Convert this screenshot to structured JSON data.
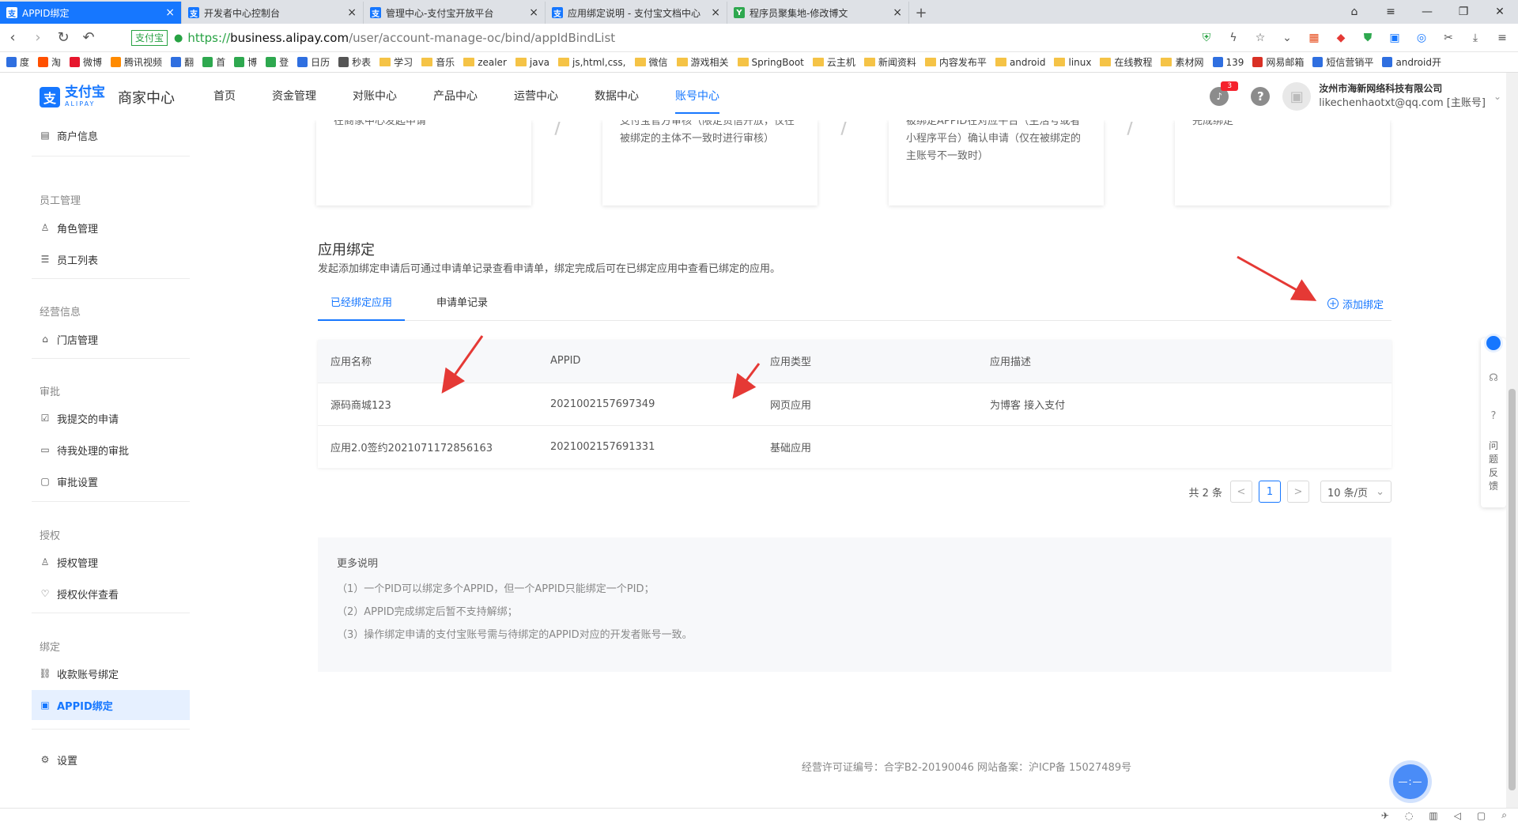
{
  "browser": {
    "tabs": [
      {
        "title": "APPID绑定",
        "active": true,
        "fav": "支",
        "fav_color": "#1677ff"
      },
      {
        "title": "开发者中心控制台",
        "active": false,
        "fav": "支",
        "fav_color": "#1677ff"
      },
      {
        "title": "管理中心-支付宝开放平台",
        "active": false,
        "fav": "支",
        "fav_color": "#1677ff"
      },
      {
        "title": "应用绑定说明 - 支付宝文档中心",
        "active": false,
        "fav": "支",
        "fav_color": "#1677ff"
      },
      {
        "title": "程序员聚集地-修改博文",
        "active": false,
        "fav": "Y",
        "fav_color": "#2ea84f"
      }
    ],
    "address": {
      "cert": "支付宝",
      "scheme": "https://",
      "host": "business.alipay.com",
      "path": "/user/account-manage-oc/bind/appIdBindList"
    },
    "bookmarks": [
      {
        "label": "度",
        "type": "icon",
        "color": "#2f6fe0"
      },
      {
        "label": "淘",
        "type": "icon",
        "color": "#ff5000"
      },
      {
        "label": "微博",
        "type": "icon",
        "color": "#e6162d"
      },
      {
        "label": "腾讯视频",
        "type": "icon",
        "color": "#ff8a00"
      },
      {
        "label": "翻",
        "type": "icon",
        "color": "#2f6fe0"
      },
      {
        "label": "首",
        "type": "icon",
        "color": "#2ea84f"
      },
      {
        "label": "博",
        "type": "icon",
        "color": "#2ea84f"
      },
      {
        "label": "登",
        "type": "icon",
        "color": "#2ea84f"
      },
      {
        "label": "日历",
        "type": "icon",
        "color": "#2f6fe0"
      },
      {
        "label": "秒表",
        "type": "icon",
        "color": "#555555"
      },
      {
        "label": "学习",
        "type": "folder"
      },
      {
        "label": "音乐",
        "type": "folder"
      },
      {
        "label": "zealer",
        "type": "folder"
      },
      {
        "label": "java",
        "type": "folder"
      },
      {
        "label": "js,html,css,",
        "type": "folder"
      },
      {
        "label": "微信",
        "type": "folder"
      },
      {
        "label": "游戏相关",
        "type": "folder"
      },
      {
        "label": "SpringBoot",
        "type": "folder"
      },
      {
        "label": "云主机",
        "type": "folder"
      },
      {
        "label": "新闻资料",
        "type": "folder"
      },
      {
        "label": "内容发布平",
        "type": "folder"
      },
      {
        "label": "android",
        "type": "folder"
      },
      {
        "label": "linux",
        "type": "folder"
      },
      {
        "label": "在线教程",
        "type": "folder"
      },
      {
        "label": "素材网",
        "type": "folder"
      },
      {
        "label": "139",
        "type": "icon",
        "color": "#2f6fe0"
      },
      {
        "label": "网易邮箱",
        "type": "icon",
        "color": "#d93025"
      },
      {
        "label": "短信营销平",
        "type": "icon",
        "color": "#2f6fe0"
      },
      {
        "label": "android开",
        "type": "icon",
        "color": "#2f6fe0"
      }
    ]
  },
  "header": {
    "logo_cn": "支付宝",
    "logo_en": "ALIPAY",
    "logo_sub": "商家中心",
    "nav": [
      {
        "label": "首页",
        "active": false
      },
      {
        "label": "资金管理",
        "active": false
      },
      {
        "label": "对账中心",
        "active": false
      },
      {
        "label": "产品中心",
        "active": false
      },
      {
        "label": "运营中心",
        "active": false
      },
      {
        "label": "数据中心",
        "active": false
      },
      {
        "label": "账号中心",
        "active": true
      }
    ],
    "notify_count": "3",
    "company": "汝州市海新网络科技有限公司",
    "account": "likechenhaotxt@qq.com [主账号]"
  },
  "sidebar": {
    "merchant_info": "商户信息",
    "group_staff": "员工管理",
    "role_mgmt": "角色管理",
    "staff_list": "员工列表",
    "group_biz": "经营信息",
    "store_mgmt": "门店管理",
    "group_approval": "审批",
    "my_applications": "我提交的申请",
    "pending_approvals": "待我处理的审批",
    "approval_settings": "审批设置",
    "group_auth": "授权",
    "auth_mgmt": "授权管理",
    "auth_partner": "授权伙伴查看",
    "group_bind": "绑定",
    "collection_bind": "收款账号绑定",
    "appid_bind": "APPID绑定",
    "settings": "设置"
  },
  "steps": [
    {
      "text": "在商家中心发起申请"
    },
    {
      "text": "支付宝官方审核（限定货信开放，仅在被绑定的主体不一致时进行审核）"
    },
    {
      "text": "被绑定APPID在对应平台（生活号或者小程序平台）确认申请（仅在被绑定的主账号不一致时）"
    },
    {
      "text": "完成绑定"
    }
  ],
  "main": {
    "title": "应用绑定",
    "description": "发起添加绑定申请后可通过申请单记录查看申请单，绑定完成后可在已绑定应用中查看已绑定的应用。",
    "tab_bound": "已经绑定应用",
    "tab_records": "申请单记录",
    "add_bind": "添加绑定",
    "columns": [
      "应用名称",
      "APPID",
      "应用类型",
      "应用描述"
    ],
    "rows": [
      [
        "源码商城123",
        "2021002157697349",
        "网页应用",
        "为博客 接入支付"
      ],
      [
        "应用2.0签约2021071172856163",
        "2021002157691331",
        "基础应用",
        ""
      ]
    ],
    "pager_total": "共 2 条",
    "pager_prev": "<",
    "pager_current": "1",
    "pager_next": ">",
    "pager_size": "10 条/页",
    "notes_title": "更多说明",
    "notes": [
      "（1）一个PID可以绑定多个APPID，但一个APPID只能绑定一个PID；",
      "（2）APPID完成绑定后暂不支持解绑；",
      "（3）操作绑定申请的支付宝账号需与待绑定的APPID对应的开发者账号一致。"
    ],
    "footer": "经营许可证编号：合字B2-20190046 网站备案：沪ICP备 15027489号"
  },
  "float_tool": {
    "feedback": "问题反馈"
  },
  "chat_bubble": "—:—"
}
